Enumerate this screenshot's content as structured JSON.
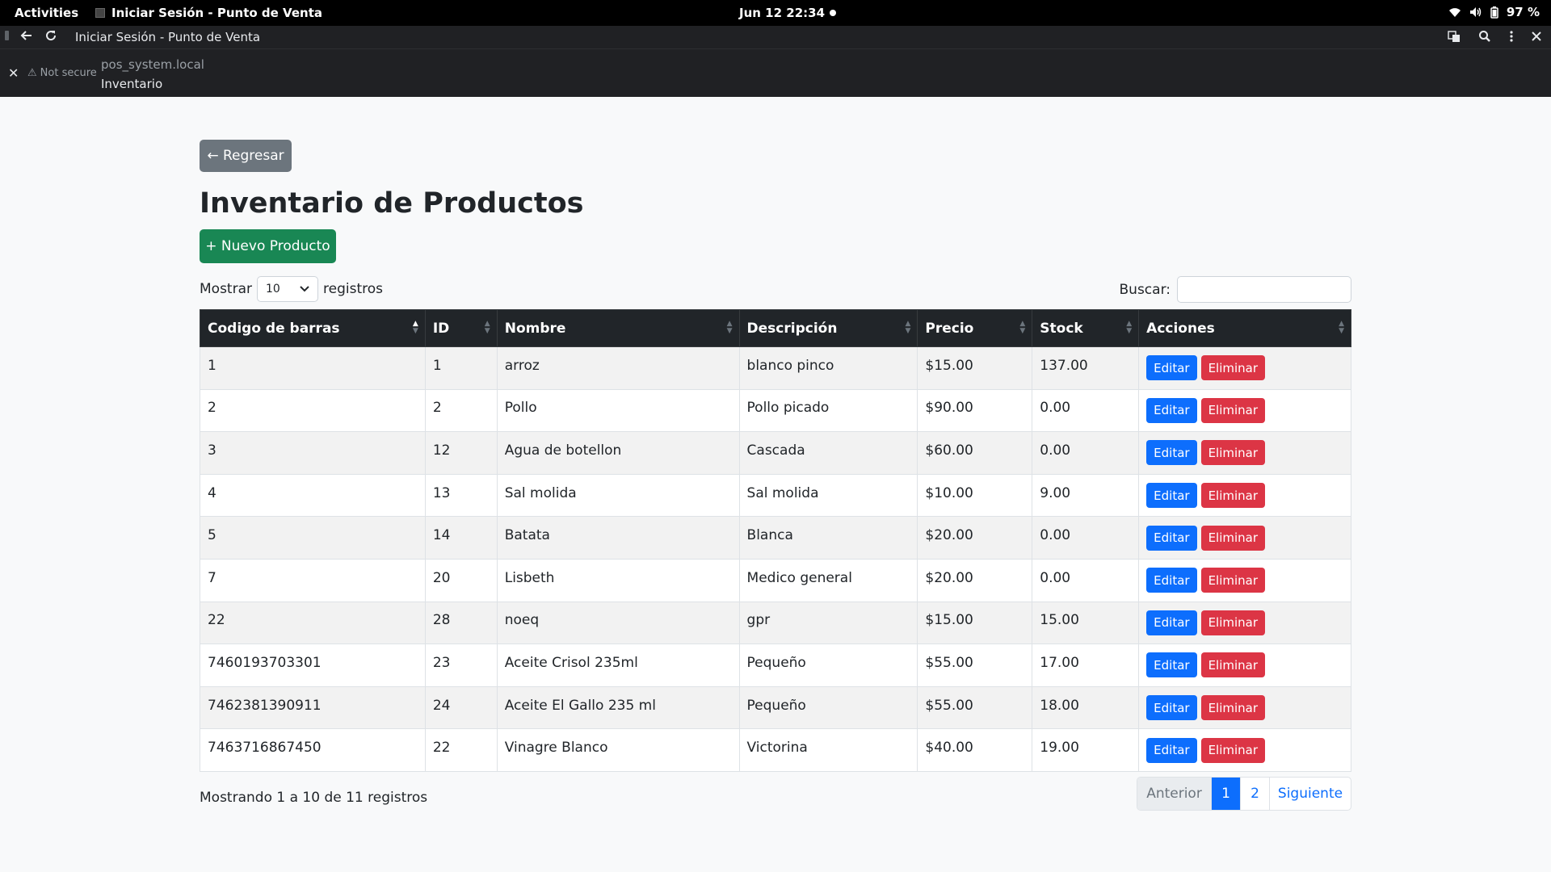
{
  "topbar": {
    "activities": "Activities",
    "app_name": "Iniciar Sesión - Punto de Venta",
    "clock": "Jun 12  22:34",
    "battery": "97 %"
  },
  "browser": {
    "tab_title": "Iniciar Sesión - Punto de Venta",
    "security": "Not secure",
    "domain": "pos_system.local",
    "page_title": "Inventario"
  },
  "page": {
    "back_label": "← Regresar",
    "title": "Inventario de Productos",
    "new_label": "+ Nuevo Producto",
    "show_label": "Mostrar",
    "show_value": "10",
    "records_label": "registros",
    "search_label": "Buscar:",
    "search_value": ""
  },
  "table": {
    "columns": [
      "Codigo de barras",
      "ID",
      "Nombre",
      "Descripción",
      "Precio",
      "Stock",
      "Acciones"
    ],
    "edit_label": "Editar",
    "delete_label": "Eliminar",
    "rows": [
      [
        "1",
        "1",
        "arroz",
        "blanco pinco",
        "$15.00",
        "137.00"
      ],
      [
        "2",
        "2",
        "Pollo",
        "Pollo picado",
        "$90.00",
        "0.00"
      ],
      [
        "3",
        "12",
        "Agua de botellon",
        "Cascada",
        "$60.00",
        "0.00"
      ],
      [
        "4",
        "13",
        "Sal molida",
        "Sal molida",
        "$10.00",
        "9.00"
      ],
      [
        "5",
        "14",
        "Batata",
        "Blanca",
        "$20.00",
        "0.00"
      ],
      [
        "7",
        "20",
        "Lisbeth",
        "Medico general",
        "$20.00",
        "0.00"
      ],
      [
        "22",
        "28",
        "noeq",
        "gpr",
        "$15.00",
        "15.00"
      ],
      [
        "7460193703301",
        "23",
        "Aceite Crisol 235ml",
        "Pequeño",
        "$55.00",
        "17.00"
      ],
      [
        "7462381390911",
        "24",
        "Aceite El Gallo 235 ml",
        "Pequeño",
        "$55.00",
        "18.00"
      ],
      [
        "7463716867450",
        "22",
        "Vinagre Blanco",
        "Victorina",
        "$40.00",
        "19.00"
      ]
    ]
  },
  "footer": {
    "info": "Mostrando 1 a 10 de 11 registros",
    "prev": "Anterior",
    "pages": [
      "1",
      "2"
    ],
    "next": "Siguiente"
  }
}
